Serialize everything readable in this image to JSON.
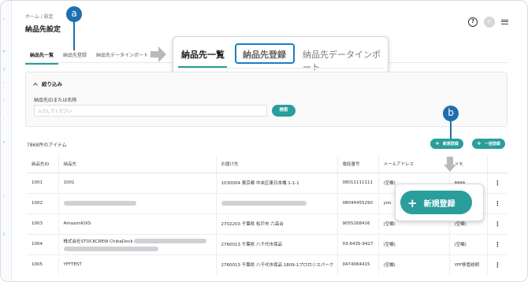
{
  "left_rail": [
    "ᵥ",
    "ᴮ",
    "ｼ",
    "ﾞ",
    "ﾞ",
    "ﾞ",
    "ᵍ",
    "ﾞ",
    "ｼ"
  ],
  "breadcrumb": "ホーム / 設定",
  "page_title": "納品先設定",
  "header": {
    "help_icon": "?",
    "avatar_initial": "F"
  },
  "tabs": [
    "納品先一覧",
    "納品先登録",
    "納品先データインポート"
  ],
  "zoom_tabs": [
    "納品先一覧",
    "納品先登録",
    "納品先データインポート"
  ],
  "badges": {
    "a": "a",
    "b": "b"
  },
  "filter": {
    "title": "絞り込み",
    "label": "納品先IDまたは名称",
    "placeholder": "入力してください",
    "search_label": "検索"
  },
  "list": {
    "count": "7868件のアイテム",
    "new_button": "新規登録",
    "bulk_button": "一括登録"
  },
  "zoom_new_button": "新規登録",
  "table": {
    "headers": [
      "納品先ID",
      "納品先",
      "お届け先",
      "電話番号",
      "メールアドレス",
      "メモ",
      ""
    ],
    "rows": [
      {
        "id": "1001",
        "name": "1001",
        "address": "1030004 東京都 中央区東日本橋 1-1-1",
        "phone": "08011111111",
        "email": "(空欄)",
        "memo": "aaaa"
      },
      {
        "id": "1002",
        "name": "",
        "address": "",
        "phone": "08044455290",
        "email": "yoo",
        "memo": ""
      },
      {
        "id": "1003",
        "name": "AmazonKIXS",
        "address": "2702203 千葉県 松戸市 六高台",
        "phone": "9055268416",
        "email": "(空欄)",
        "memo": "(空欄)"
      },
      {
        "id": "1004",
        "name": "株式会社STOCKCREW ChibaDock",
        "address": "2760013 千葉県 八千代市保品",
        "phone": "03-6435-9427",
        "email": "(空欄)",
        "memo": "(空欄)"
      },
      {
        "id": "1005",
        "name": "YFFTEST",
        "address": "2760013 千葉県 八千代市保品 1809-1プロロジスパーク",
        "phone": "0474064415",
        "email": "(空欄)",
        "memo": "YFF移管説明"
      }
    ]
  },
  "colors": {
    "accent": "#2a9d9d",
    "badge": "#1d6fae",
    "highlight": "#1a7fc4"
  }
}
